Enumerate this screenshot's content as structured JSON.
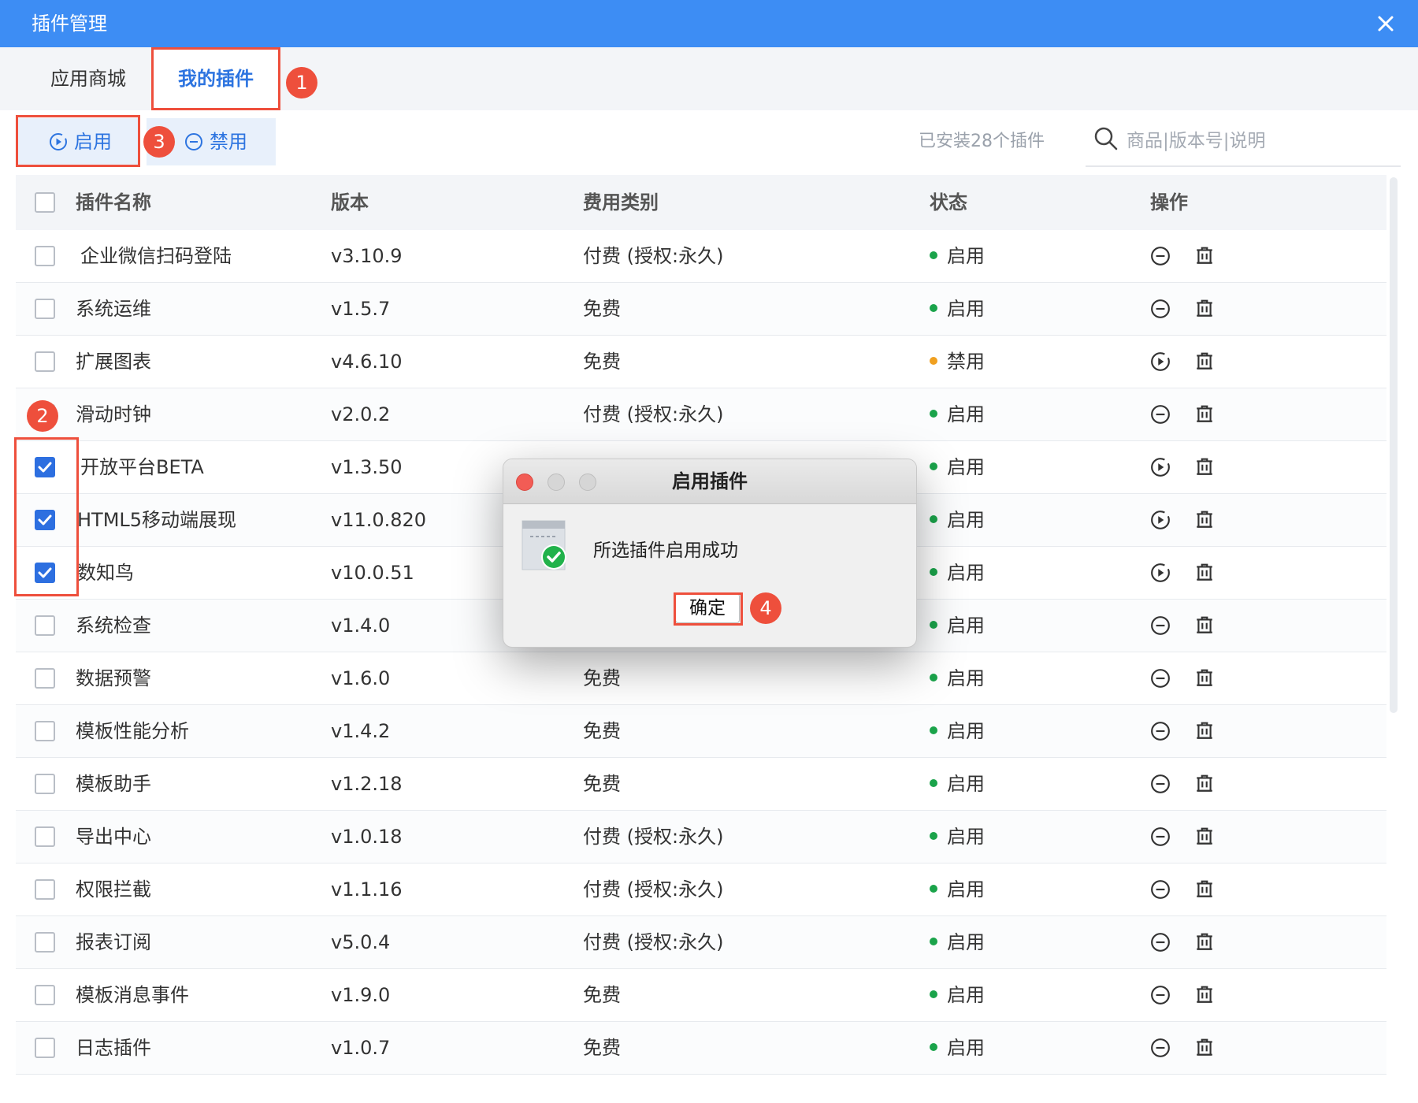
{
  "window": {
    "title": "插件管理"
  },
  "tabs": [
    {
      "label": "应用商城",
      "active": false
    },
    {
      "label": "我的插件",
      "active": true
    }
  ],
  "toolbar": {
    "enable_label": "启用",
    "disable_label": "禁用",
    "installed_text": "已安装28个插件"
  },
  "search": {
    "placeholder": "商品|版本号|说明",
    "value": ""
  },
  "table": {
    "headers": {
      "name": "插件名称",
      "version": "版本",
      "fee": "费用类别",
      "status": "状态",
      "actions": "操作"
    },
    "rows": [
      {
        "name": "企业微信扫码登陆",
        "version": "v3.10.9",
        "fee": "付费 (授权:永久)",
        "status": "启用",
        "checked": false
      },
      {
        "name": "系统运维",
        "version": "v1.5.7",
        "fee": "免费",
        "status": "启用",
        "checked": false
      },
      {
        "name": "扩展图表",
        "version": "v4.6.10",
        "fee": "免费",
        "status": "禁用",
        "checked": false
      },
      {
        "name": "滑动时钟",
        "version": "v2.0.2",
        "fee": "付费 (授权:永久)",
        "status": "启用",
        "checked": false
      },
      {
        "name": "开放平台BETA",
        "version": "v1.3.50",
        "fee": "",
        "status": "启用",
        "checked": true
      },
      {
        "name": "HTML5移动端展现",
        "version": "v11.0.820",
        "fee": "",
        "status": "启用",
        "checked": true
      },
      {
        "name": "数知鸟",
        "version": "v10.0.51",
        "fee": "",
        "status": "启用",
        "checked": true
      },
      {
        "name": "系统检查",
        "version": "v1.4.0",
        "fee": "",
        "status": "启用",
        "checked": false
      },
      {
        "name": "数据预警",
        "version": "v1.6.0",
        "fee": "免费",
        "status": "启用",
        "checked": false
      },
      {
        "name": "模板性能分析",
        "version": "v1.4.2",
        "fee": "免费",
        "status": "启用",
        "checked": false
      },
      {
        "name": "模板助手",
        "version": "v1.2.18",
        "fee": "免费",
        "status": "启用",
        "checked": false
      },
      {
        "name": "导出中心",
        "version": "v1.0.18",
        "fee": "付费 (授权:永久)",
        "status": "启用",
        "checked": false
      },
      {
        "name": "权限拦截",
        "version": "v1.1.16",
        "fee": "付费 (授权:永久)",
        "status": "启用",
        "checked": false
      },
      {
        "name": "报表订阅",
        "version": "v5.0.4",
        "fee": "付费 (授权:永久)",
        "status": "启用",
        "checked": false
      },
      {
        "name": "模板消息事件",
        "version": "v1.9.0",
        "fee": "免费",
        "status": "启用",
        "checked": false
      },
      {
        "name": "日志插件",
        "version": "v1.0.7",
        "fee": "免费",
        "status": "启用",
        "checked": false
      }
    ]
  },
  "dialog": {
    "title": "启用插件",
    "message": "所选插件启用成功",
    "ok_label": "确定"
  },
  "annotations": [
    "1",
    "2",
    "3",
    "4"
  ],
  "colors": {
    "titlebar": "#3d8df4",
    "accent": "#2d74e0",
    "status_enabled": "#1aa34a",
    "status_disabled": "#f0a020",
    "annotation": "#ee4f3c"
  }
}
